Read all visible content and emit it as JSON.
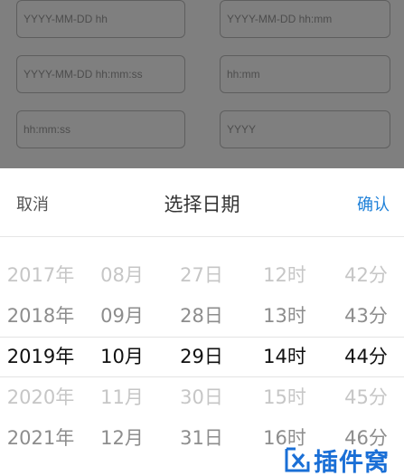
{
  "form": {
    "fields": [
      {
        "placeholder": "YYYY-MM-DD hh"
      },
      {
        "placeholder": "YYYY-MM-DD hh:mm"
      },
      {
        "placeholder": "YYYY-MM-DD hh:mm:ss"
      },
      {
        "placeholder": "hh:mm"
      },
      {
        "placeholder": "hh:mm:ss"
      },
      {
        "placeholder": "YYYY"
      }
    ]
  },
  "picker": {
    "cancel_label": "取消",
    "title": "选择日期",
    "confirm_label": "确认",
    "columns": [
      {
        "items": [
          "2017年",
          "2018年",
          "2019年",
          "2020年",
          "2021年"
        ]
      },
      {
        "items": [
          "08月",
          "09月",
          "10月",
          "11月",
          "12月"
        ]
      },
      {
        "items": [
          "27日",
          "28日",
          "29日",
          "30日",
          "31日"
        ]
      },
      {
        "items": [
          "12时",
          "13时",
          "14时",
          "15时",
          "16时"
        ]
      },
      {
        "items": [
          "42分",
          "43分",
          "44分",
          "45分",
          "46分"
        ]
      }
    ],
    "selected": {
      "year": "2019年",
      "month": "10月",
      "day": "29日",
      "hour": "14时",
      "minute": "44分"
    }
  },
  "watermark": {
    "text": "插件窝",
    "icon": "logo-icon",
    "color": "#1a6fd6"
  },
  "colors": {
    "accent": "#1e80d8"
  }
}
